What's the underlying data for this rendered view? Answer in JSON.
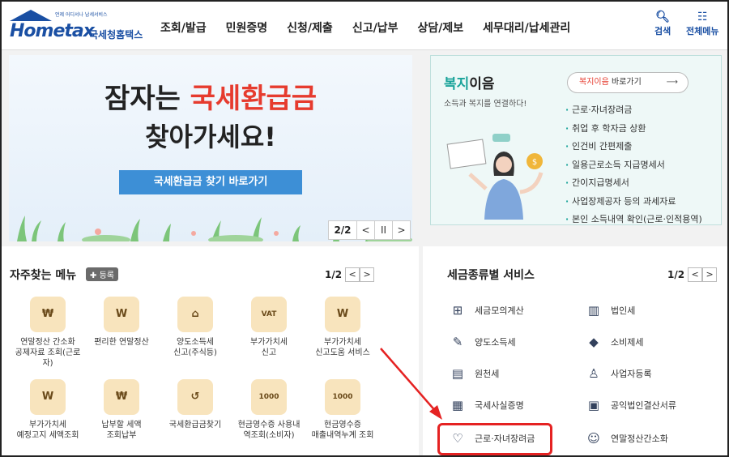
{
  "header": {
    "logo_tagline": "언제 어디서나 납세서비스",
    "logo_brand": "Hometax",
    "logo_brand_kr": "국세청홈택스",
    "nav": [
      "조회/발급",
      "민원증명",
      "신청/제출",
      "신고/납부",
      "상담/제보",
      "세무대리/납세관리"
    ],
    "search_label": "검색",
    "allmenu_label": "전체메뉴"
  },
  "banner": {
    "line1_a": "잠자는",
    "line1_b": "국세환급금",
    "line2": "찾아가세요!",
    "button": "국세환급금 찾기 바로가기",
    "page": "2/2",
    "prev": "<",
    "pause": "II",
    "next": ">"
  },
  "welfare": {
    "title_a": "복지",
    "title_b": "이음",
    "subtitle": "소득과 복지를 연결하다!",
    "go_a": "복지이음",
    "go_b": " 바로가기",
    "go_arrow": "⟶",
    "items": [
      "근로·자녀장려금",
      "취업 후 학자금 상환",
      "인건비 간편제출",
      "일용근로소득 지급명세서",
      "간이지급명세서",
      "사업장제공자 등의 과세자료",
      "본인 소득내역 확인(근로·인적용역)"
    ]
  },
  "frequent": {
    "title": "자주찾는 메뉴",
    "add": "등록",
    "page": "1/2",
    "prev": "<",
    "next": ">",
    "items": [
      {
        "label": "연말정산 간소화\n공제자료 조회(근로\n자)",
        "icon": "money-bag-icon",
        "sym": "₩"
      },
      {
        "label": "편리한 연말정산",
        "icon": "coin-w-icon",
        "sym": "W"
      },
      {
        "label": "양도소득세\n신고(주식등)",
        "icon": "house-icon",
        "sym": "⌂"
      },
      {
        "label": "부가가치세\n신고",
        "icon": "vat-doc-icon",
        "sym": "VAT"
      },
      {
        "label": "부가가치세\n신고도움 서비스",
        "icon": "w-search-icon",
        "sym": "W"
      },
      {
        "label": "부가가치세\n예정고지 세액조회",
        "icon": "w-doc-search-icon",
        "sym": "W"
      },
      {
        "label": "납부할 세액\n조회납부",
        "icon": "tax-bag-icon",
        "sym": "₩"
      },
      {
        "label": "국세환급금찾기",
        "icon": "refund-icon",
        "sym": "↺"
      },
      {
        "label": "현금영수증 사용내\n역조회(소비자)",
        "icon": "receipt-icon",
        "sym": "1000"
      },
      {
        "label": "현금영수증\n매출내역누계 조회",
        "icon": "receipt-sales-icon",
        "sym": "1000"
      }
    ]
  },
  "services": {
    "title": "세금종류별 서비스",
    "page": "1/2",
    "prev": "<",
    "next": ">",
    "items": [
      {
        "label": "세금모의계산",
        "icon": "calculator-icon",
        "sym": "⊞"
      },
      {
        "label": "법인세",
        "icon": "building-icon",
        "sym": "▥"
      },
      {
        "label": "양도소득세",
        "icon": "doc-pen-icon",
        "sym": "✎"
      },
      {
        "label": "소비제세",
        "icon": "diamond-icon",
        "sym": "◆"
      },
      {
        "label": "원천세",
        "icon": "sal-doc-icon",
        "sym": "▤"
      },
      {
        "label": "사업자등록",
        "icon": "person-icon",
        "sym": "♙"
      },
      {
        "label": "국세사실증명",
        "icon": "certificate-icon",
        "sym": "▦"
      },
      {
        "label": "공익법인결산서류",
        "icon": "clipboard-icon",
        "sym": "▣"
      },
      {
        "label": "근로·자녀장려금",
        "icon": "heart-hands-icon",
        "sym": "♡"
      },
      {
        "label": "연말정산간소화",
        "icon": "face-w-icon",
        "sym": "☺"
      }
    ]
  },
  "colors": {
    "accent": "#1a4fa3",
    "highlight": "#e52222",
    "teal": "#1aa39a"
  }
}
